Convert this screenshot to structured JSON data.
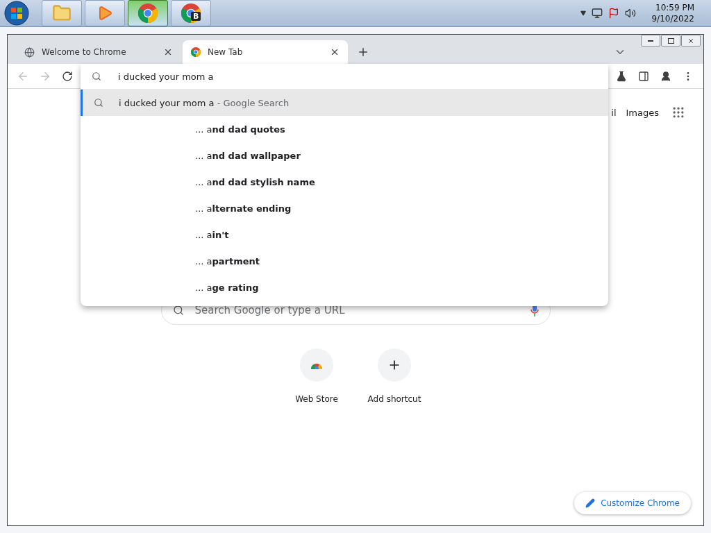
{
  "taskbar": {
    "apps": [
      {
        "kind": "explorer",
        "selected": false
      },
      {
        "kind": "media",
        "selected": false
      },
      {
        "kind": "chrome",
        "selected": true
      },
      {
        "kind": "chrome-badge",
        "badge": "B",
        "selected": false
      }
    ],
    "clock": {
      "time": "10:59 PM",
      "date": "9/10/2022"
    }
  },
  "browser": {
    "tabs": [
      {
        "title": "Welcome to Chrome",
        "kind": "globe",
        "selected": false
      },
      {
        "title": "New Tab",
        "kind": "chrome",
        "selected": true
      }
    ],
    "omnibox": {
      "value": "i ducked your mom a"
    },
    "suggestions": [
      {
        "kind": "search",
        "text": "i ducked your mom a",
        "suffix": "- Google Search",
        "selected": true
      },
      {
        "kind": "tail",
        "text": "... a**nd dad quotes**",
        "selected": false
      },
      {
        "kind": "tail",
        "text": "... a**nd dad wallpaper**",
        "selected": false
      },
      {
        "kind": "tail",
        "text": "... a**nd dad stylish name**",
        "selected": false
      },
      {
        "kind": "tail",
        "text": "... a**lternate ending**",
        "selected": false
      },
      {
        "kind": "tail",
        "text": "... a**in't**",
        "selected": false
      },
      {
        "kind": "tail",
        "text": "... a**partment**",
        "selected": false
      },
      {
        "kind": "tail",
        "text": "... a**ge rating**",
        "selected": false
      }
    ],
    "page": {
      "links": [
        "il",
        "Images"
      ],
      "search": {
        "placeholder": "Search Google or type a URL"
      },
      "shortcuts": [
        {
          "kind": "webstore",
          "label": "Web Store"
        },
        {
          "kind": "add",
          "label": "Add shortcut"
        }
      ],
      "customize": "Customize Chrome"
    }
  }
}
